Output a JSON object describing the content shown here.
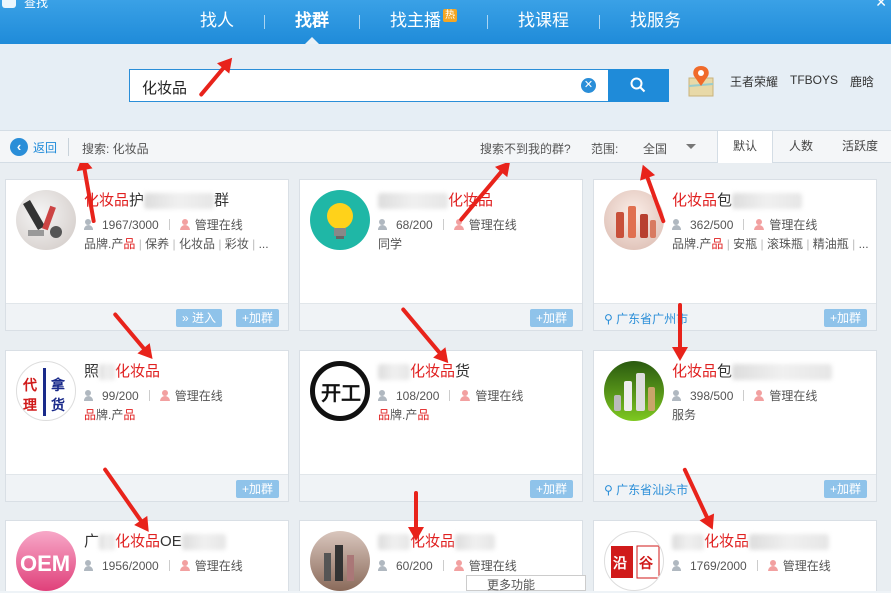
{
  "app": {
    "title": "查找"
  },
  "tabs": [
    {
      "label": "找人"
    },
    {
      "label": "找群"
    },
    {
      "label": "找主播",
      "badge": "热"
    },
    {
      "label": "找课程"
    },
    {
      "label": "找服务"
    }
  ],
  "search": {
    "query": "化妆品",
    "hot_words": [
      "王者荣耀",
      "TFBOYS",
      "鹿晗"
    ]
  },
  "filter": {
    "back": "返回",
    "crumb": "搜索: 化妆品",
    "not_found": "搜索不到我的群?",
    "range_label": "范围:",
    "range_value": "全国",
    "sorts": [
      "默认",
      "人数",
      "活跃度"
    ]
  },
  "cards": [
    {
      "name_hl": "化妆品",
      "name_tail": "护",
      "name_tail2": "群",
      "count": "1967/3000",
      "admin": "管理在线",
      "tags": [
        "品牌.产品",
        "保养",
        "化妆品",
        "彩妆",
        "..."
      ],
      "enter": "进入",
      "join": "+加群",
      "location": ""
    },
    {
      "name_pre": "",
      "name_hl": "化妆品",
      "count": "68/200",
      "admin": "管理在线",
      "tags_plain": "同学",
      "join": "+加群",
      "location": ""
    },
    {
      "name_hl": "化妆品",
      "name_tail": "包",
      "count": "362/500",
      "admin": "管理在线",
      "tags": [
        "品牌.产品",
        "安瓶",
        "滚珠瓶",
        "精油瓶",
        "..."
      ],
      "join": "+加群",
      "location": "广东省广州市"
    },
    {
      "name_pre": "照",
      "name_hl": "化妆品",
      "count": "99/200",
      "admin": "管理在线",
      "tags": [
        "品牌.产品"
      ],
      "join": "+加群",
      "location": ""
    },
    {
      "name_hl": "化妆品",
      "name_tail": "货",
      "count": "108/200",
      "admin": "管理在线",
      "tags": [
        "品牌.产品"
      ],
      "join": "+加群",
      "location": ""
    },
    {
      "name_hl": "化妆品",
      "name_tail": "包",
      "count": "398/500",
      "admin": "管理在线",
      "tags_plain": "服务",
      "join": "+加群",
      "location": "广东省汕头市"
    },
    {
      "name_pre": "广",
      "name_hl": "化妆品",
      "name_tail": "OE",
      "count": "1956/2000",
      "admin": "管理在线"
    },
    {
      "name_hl": "化妆品",
      "count": "60/200",
      "admin": "管理在线"
    },
    {
      "name_hl": "化妆品",
      "count": "1769/2000",
      "admin": "管理在线"
    }
  ],
  "tooltip": {
    "text": "更多功能"
  }
}
